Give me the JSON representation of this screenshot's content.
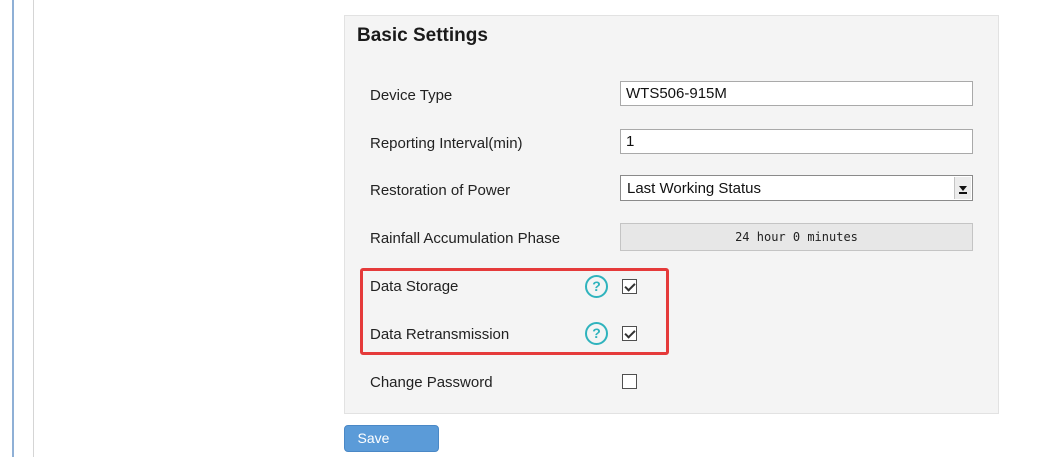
{
  "settings": {
    "title": "Basic Settings",
    "device_type": {
      "label": "Device Type",
      "value": "WTS506-915M"
    },
    "reporting_interval": {
      "label": "Reporting Interval(min)",
      "value": "1"
    },
    "restoration_of_power": {
      "label": "Restoration of Power",
      "selected": "Last Working Status"
    },
    "rainfall_phase": {
      "label": "Rainfall Accumulation Phase",
      "value": "24 hour 0 minutes"
    },
    "data_storage": {
      "label": "Data Storage",
      "help_icon": "question-icon",
      "checked": true
    },
    "data_retransmission": {
      "label": "Data Retransmission",
      "help_icon": "question-icon",
      "checked": true
    },
    "change_password": {
      "label": "Change Password",
      "checked": false
    },
    "save_label": "Save"
  },
  "colors": {
    "help_icon": "#2fb3bd",
    "highlight": "#e53a3a",
    "save_button": "#5b9bd8",
    "panel_background": "#f4f4f4"
  }
}
